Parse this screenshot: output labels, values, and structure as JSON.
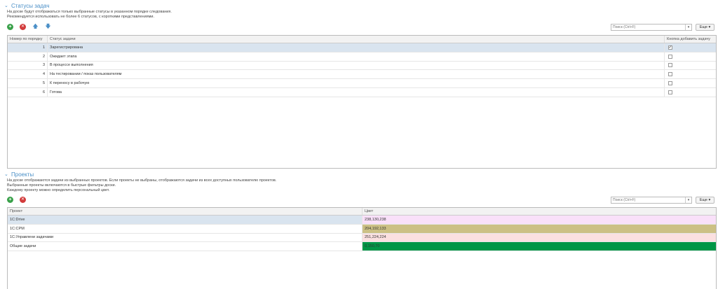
{
  "statuses_section": {
    "title": "Статусы задач",
    "description": [
      "На доске будут отображаться только выбранные статусы в указанном порядке следования.",
      "Рекомендуется использовать не более 6 статусов, с короткими представлениями."
    ],
    "search_placeholder": "Поиск (Ctrl+F)",
    "more_label": "Еще",
    "columns": [
      "Номер по порядку",
      "Статус задачи",
      "Кнопка добавить задачу"
    ],
    "rows": [
      {
        "num": "1",
        "status": "Зарегистрирована",
        "add_button": true
      },
      {
        "num": "2",
        "status": "Ожидает этапа",
        "add_button": false
      },
      {
        "num": "3",
        "status": "В процессе выполнения",
        "add_button": false
      },
      {
        "num": "4",
        "status": "На тестировании / показ пользователям",
        "add_button": false
      },
      {
        "num": "5",
        "status": "К переносу в рабочую",
        "add_button": false
      },
      {
        "num": "6",
        "status": "Готова",
        "add_button": false
      }
    ]
  },
  "projects_section": {
    "title": "Проекты",
    "description": [
      "На доске отображаются задачи из выбранных проектов. Если проекты не выбраны, отображаются задачи из всех доступных пользователю проектов.",
      "Выбранные проекты включаются в быстрые фильтры доски.",
      "Каждому проекту можно определить персональный цвет."
    ],
    "search_placeholder": "Поиск (Ctrl+F)",
    "more_label": "Еще",
    "columns": [
      "Проект",
      "Цвет"
    ],
    "rows": [
      {
        "project": "1С:Drive",
        "color_text": "238,130,238",
        "color": "#f9e0f9"
      },
      {
        "project": "1С:CPM",
        "color_text": "204,192,133",
        "color": "#ccc085"
      },
      {
        "project": "1С:Управлени задачами",
        "color_text": "251,224,224",
        "color": "#fbe0e0"
      },
      {
        "project": "Общие задачи",
        "color_text": "0,150,70",
        "color": "#009646"
      }
    ]
  }
}
